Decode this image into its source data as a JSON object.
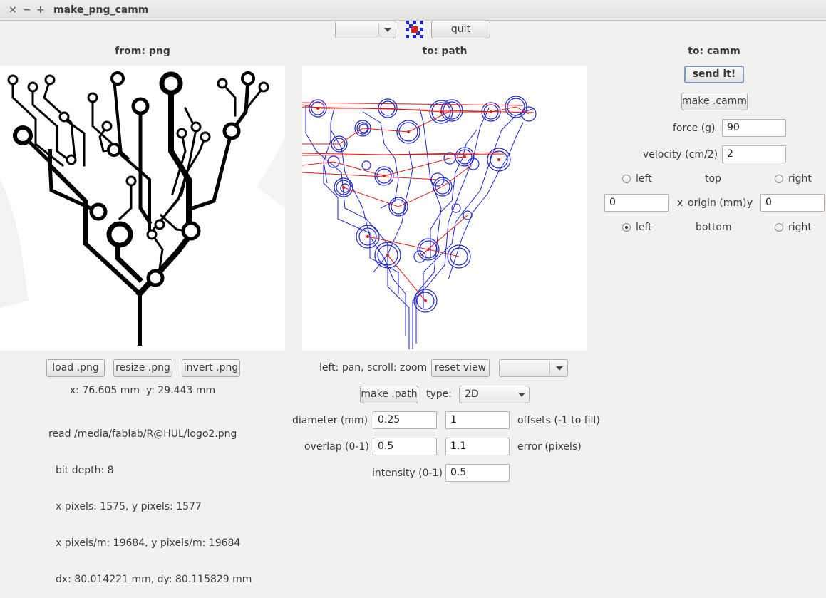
{
  "window": {
    "title": "make_png_camm",
    "controls": [
      "×",
      "−",
      "+"
    ]
  },
  "toolbar": {
    "combo_value": "",
    "quit_label": "quit",
    "logo_icon": "fab-modules-grid-icon",
    "colors": {
      "blue": "#1a2bd6",
      "red": "#e02020"
    }
  },
  "from_panel": {
    "header": "from: png",
    "buttons": {
      "load": "load .png",
      "resize": "resize .png",
      "invert": "invert .png"
    },
    "coords": "x: 76.605 mm  y: 29.443 mm",
    "info": {
      "line1": "read /media/fablab/R@HUL/logo2.png",
      "line2": "bit depth: 8",
      "line3": "x pixels: 1575, y pixels: 1577",
      "line4": "x pixels/m: 19684, y pixels/m: 19684",
      "line5": "dx: 80.014221 mm, dy: 80.115829 mm"
    }
  },
  "path_panel": {
    "header": "to: path",
    "hint": "left: pan, scroll: zoom",
    "reset_view": "reset view",
    "view_combo_value": "",
    "make_path": "make .path",
    "type_label": "type:",
    "type_value": "2D",
    "diameter_label": "diameter (mm)",
    "diameter_value": "0.25",
    "offsets_value": "1",
    "offsets_label": "offsets (-1 to fill)",
    "overlap_label": "overlap (0-1)",
    "overlap_value": "0.5",
    "error_value": "1.1",
    "error_label": "error (pixels)",
    "intensity_label": "intensity (0-1)",
    "intensity_value": "0.5",
    "colors": {
      "path": "#1c24d8",
      "move": "#e01818"
    }
  },
  "camm_panel": {
    "header": "to: camm",
    "send": "send it!",
    "make_camm": "make .camm",
    "force_label": "force (g)",
    "force_value": "90",
    "velocity_label": "velocity (cm/2)",
    "velocity_value": "2",
    "origin": {
      "left_top_label": "left",
      "top_label": "top",
      "right_top_label": "right",
      "x_value": "0",
      "x_label": "x",
      "origin_label": "origin (mm)",
      "y_label": "y",
      "y_value": "0",
      "left_bottom_label": "left",
      "bottom_label": "bottom",
      "right_bottom_label": "right",
      "selected": "left-bottom"
    }
  }
}
